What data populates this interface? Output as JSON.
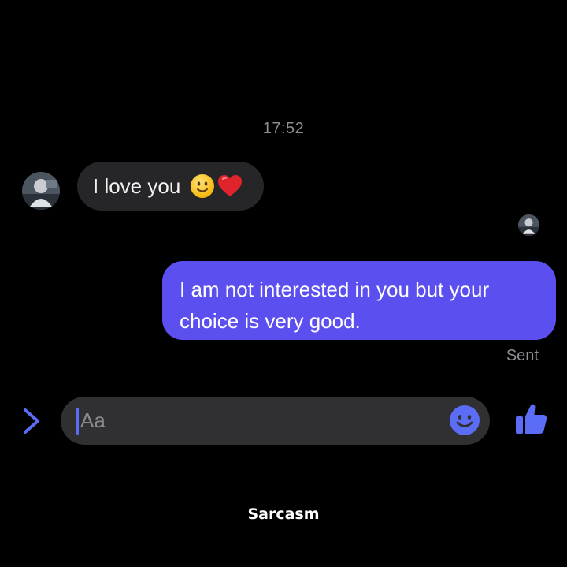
{
  "conversation": {
    "timestamp": "17:52",
    "incoming": {
      "text": "I love you",
      "emojis": [
        "slightly-smiling-face",
        "red-heart"
      ]
    },
    "outgoing": {
      "text": "I am not interested in you but your choice is very good.",
      "status": "Sent"
    }
  },
  "composer": {
    "placeholder": "Aa"
  },
  "caption": "Sarcasm",
  "colors": {
    "background": "#000000",
    "incoming_bubble": "#262629",
    "outgoing_bubble": "#5b4ff0",
    "accent": "#5b6cf5",
    "muted_text": "#8e8e93"
  }
}
